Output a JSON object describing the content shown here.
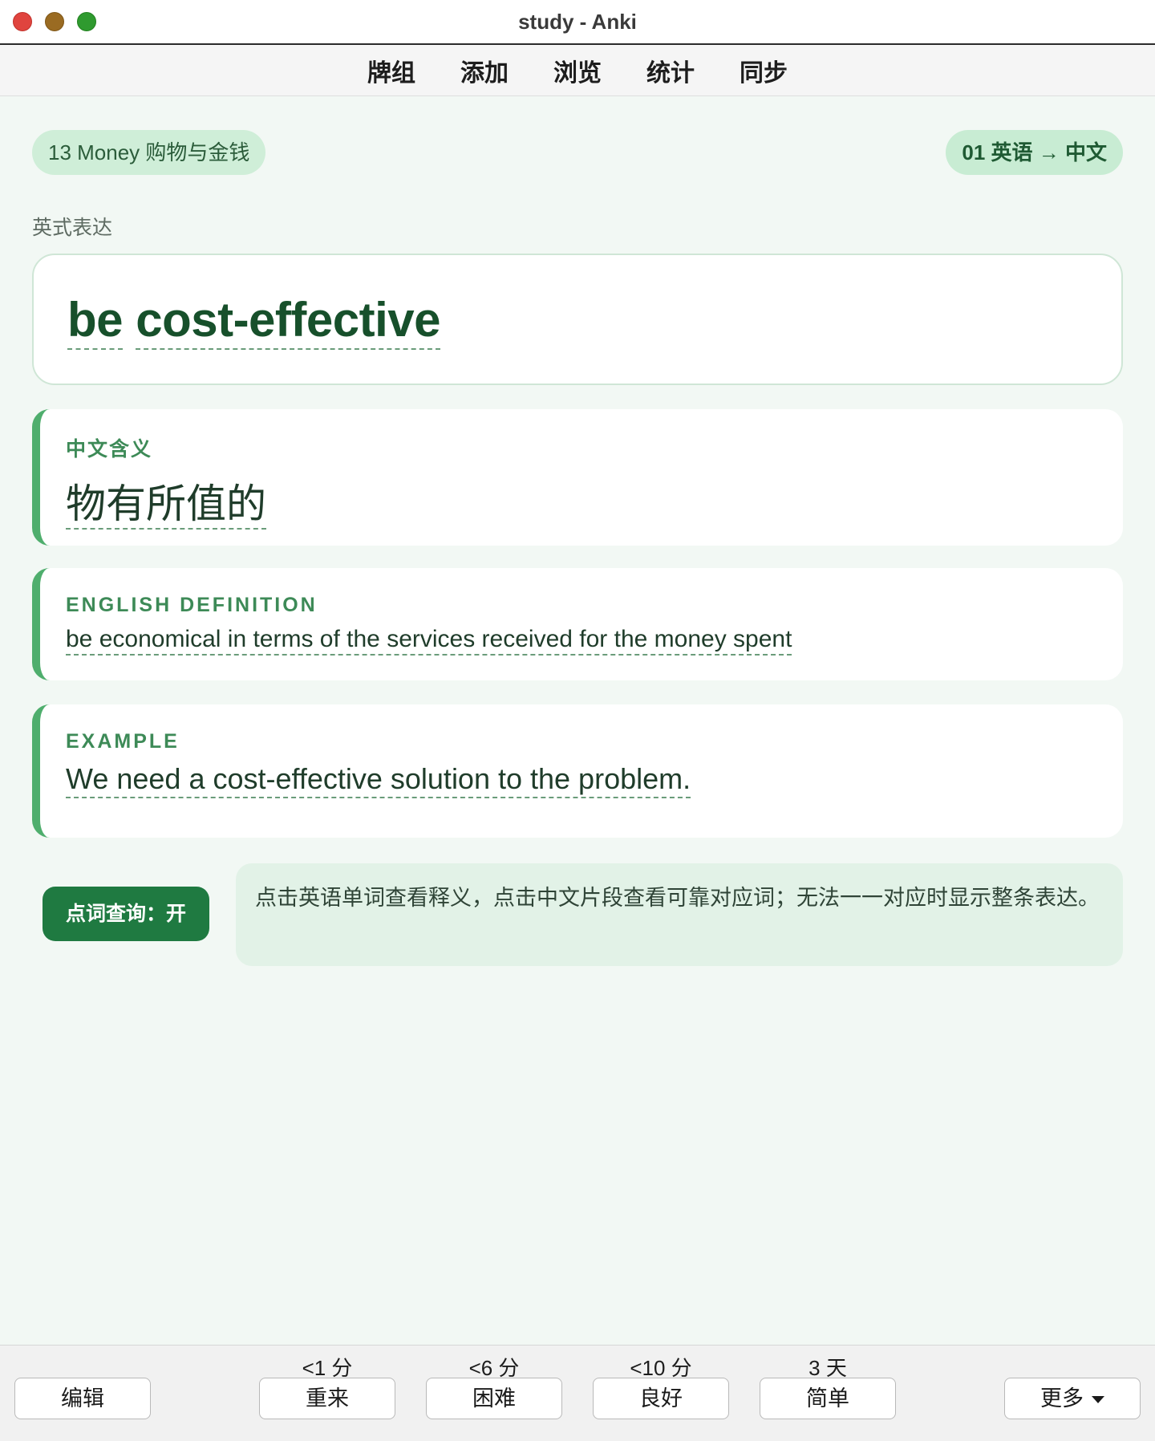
{
  "window": {
    "title": "study - Anki"
  },
  "toolbar": {
    "items": [
      "牌组",
      "添加",
      "浏览",
      "统计",
      "同步"
    ]
  },
  "card": {
    "deck_name": "13 Money 购物与金钱",
    "mode": "01 英语 → 中文",
    "expression_label": "英式表达",
    "expression_words": [
      "be",
      "cost-effective"
    ],
    "meaning_label": "中文含义",
    "meaning": "物有所值的",
    "definition_label": "ENGLISH DEFINITION",
    "definition": "be economical in terms of the services received for the money spent",
    "example_label": "EXAMPLE",
    "example": "We need a cost-effective solution to the problem."
  },
  "lookup": {
    "button_label": "点词查询：开",
    "hint": "点击英语单词查看释义，点击中文片段查看可靠对应词；无法一一对应时显示整条表达。"
  },
  "bottom": {
    "edit_label": "编辑",
    "answers": [
      {
        "label": "重来",
        "interval": "<1 分"
      },
      {
        "label": "困难",
        "interval": "<6 分"
      },
      {
        "label": "良好",
        "interval": "<10 分"
      },
      {
        "label": "简单",
        "interval": "3 天"
      }
    ],
    "more_label": "更多"
  },
  "colors": {
    "accent": "#1f7a41",
    "card_border": "#4fae6d",
    "background": "#f2f8f4"
  }
}
